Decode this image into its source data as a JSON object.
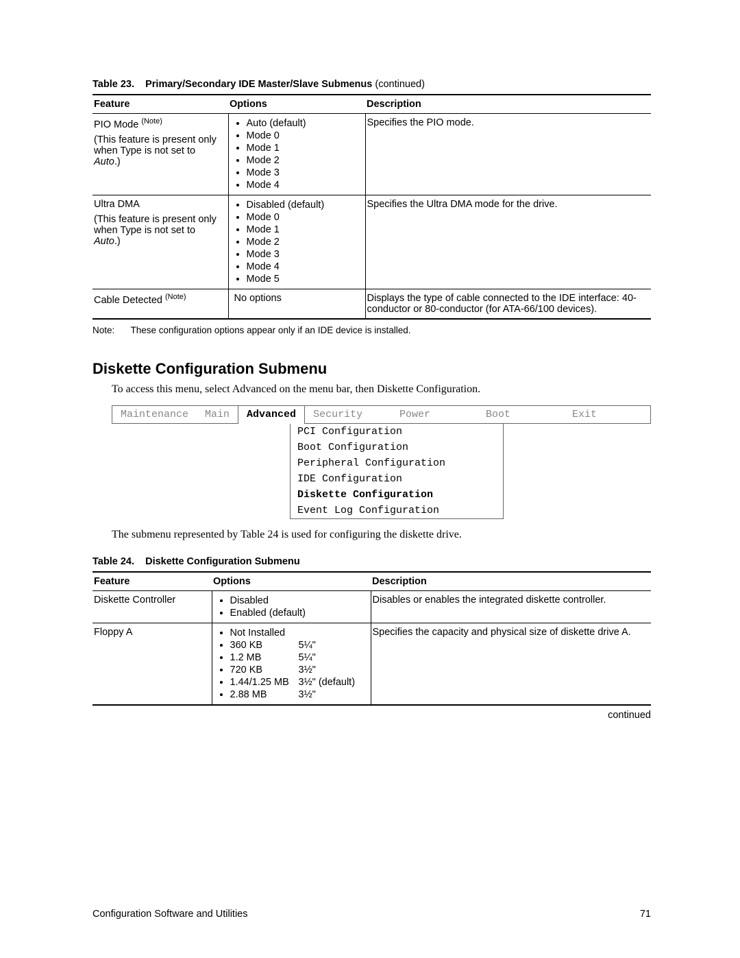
{
  "table23": {
    "caption_prefix": "Table 23.",
    "caption_title": "Primary/Secondary IDE Master/Slave Submenus",
    "caption_suffix": " (continued)",
    "headers": {
      "feature": "Feature",
      "options": "Options",
      "description": "Description"
    },
    "rows": [
      {
        "feature_main": "PIO Mode ",
        "feature_sup": "(Note)",
        "feature_sub1": "(This feature is present only when Type is not set to ",
        "feature_sub_italic": "Auto",
        "feature_sub2": ".)",
        "options": [
          "Auto (default)",
          "Mode 0",
          "Mode 1",
          "Mode 2",
          "Mode 3",
          "Mode 4"
        ],
        "description": "Specifies the PIO mode."
      },
      {
        "feature_main": "Ultra DMA",
        "feature_sup": "",
        "feature_sub1": "(This feature is present only when Type is not set to ",
        "feature_sub_italic": "Auto",
        "feature_sub2": ".)",
        "options": [
          "Disabled (default)",
          "Mode 0",
          "Mode 1",
          "Mode 2",
          "Mode 3",
          "Mode 4",
          "Mode 5"
        ],
        "description": "Specifies the Ultra DMA mode for the drive."
      },
      {
        "feature_main": "Cable Detected ",
        "feature_sup": "(Note)",
        "options_text": "No options",
        "description": "Displays the type of cable connected to the IDE interface:  40-conductor or 80-conductor (for ATA-66/100 devices)."
      }
    ],
    "note_label": "Note:",
    "note_text": "These configuration options appear only if an IDE device is installed."
  },
  "section_heading": "Diskette Configuration Submenu",
  "section_intro": "To access this menu, select Advanced on the menu bar, then Diskette Configuration.",
  "menubar": {
    "tabs": [
      "Maintenance",
      "Main",
      "Advanced",
      "Security",
      "Power",
      "Boot",
      "Exit"
    ],
    "active": "Advanced",
    "dropdown": [
      "PCI Configuration",
      "Boot Configuration",
      "Peripheral Configuration",
      "IDE Configuration",
      "Diskette Configuration",
      "Event Log Configuration"
    ],
    "selected": "Diskette Configuration"
  },
  "section_intro2": "The submenu represented by Table 24 is used for configuring the diskette drive.",
  "table24": {
    "caption_prefix": "Table 24.",
    "caption_title": "Diskette Configuration Submenu",
    "headers": {
      "feature": "Feature",
      "options": "Options",
      "description": "Description"
    },
    "rows": [
      {
        "feature": "Diskette Controller",
        "options": [
          "Disabled",
          "Enabled (default)"
        ],
        "description": "Disables or enables the integrated diskette controller."
      },
      {
        "feature": "Floppy A",
        "options2col": [
          {
            "a": "Not Installed",
            "b": ""
          },
          {
            "a": "360 KB",
            "b": "5¼\""
          },
          {
            "a": "1.2 MB",
            "b": "5¼\""
          },
          {
            "a": "720 KB",
            "b": "3½\""
          },
          {
            "a": "1.44/1.25 MB",
            "b": "3½\" (default)"
          },
          {
            "a": "2.88 MB",
            "b": "3½\""
          }
        ],
        "description": "Specifies the capacity and physical size of diskette drive A."
      }
    ],
    "continued": "continued"
  },
  "footer": {
    "left": "Configuration Software and Utilities",
    "right": "71"
  }
}
